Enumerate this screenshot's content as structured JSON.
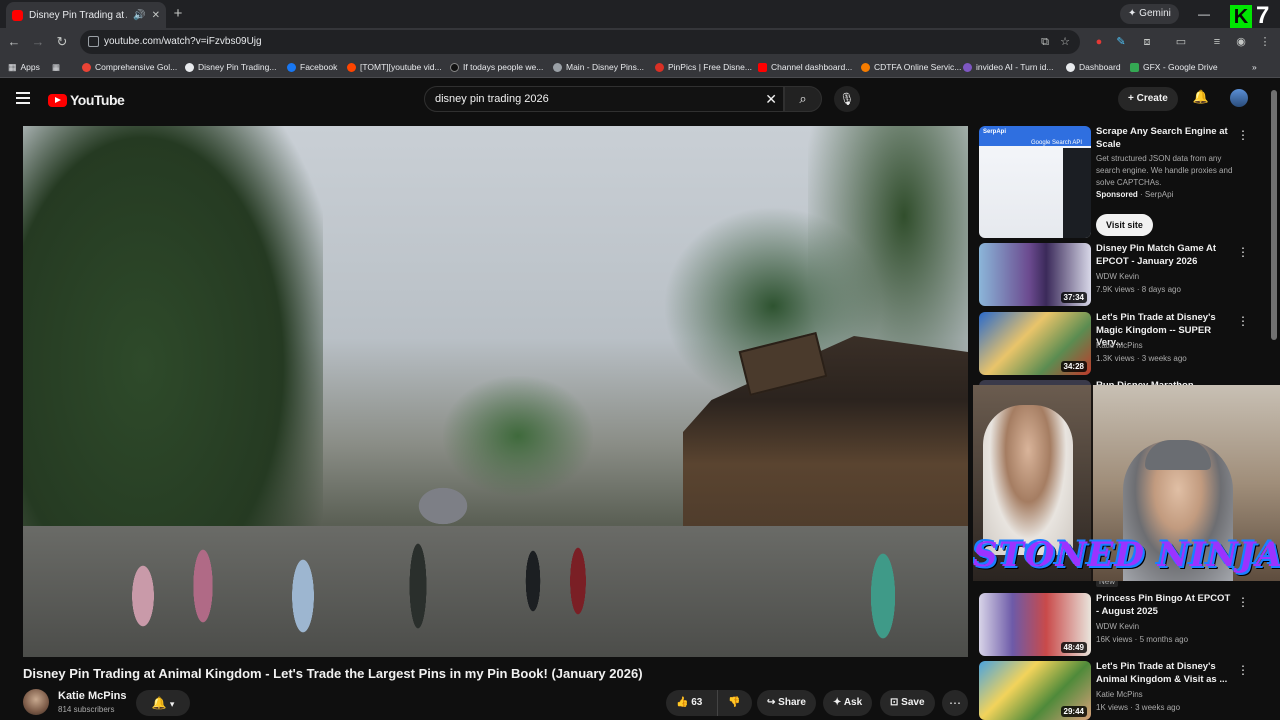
{
  "browser": {
    "tab_title": "Disney Pin Trading at Animal",
    "gemini_label": "Gemini",
    "url": "youtube.com/watch?v=iFzvbs09Ujg",
    "overlay_badge": "7",
    "bookmarks": [
      {
        "label": "Apps"
      },
      {
        "label": "Comprehensive Gol..."
      },
      {
        "label": "Disney Pin Trading..."
      },
      {
        "label": "Facebook"
      },
      {
        "label": "[TOMT][youtube vid..."
      },
      {
        "label": "If todays people we..."
      },
      {
        "label": "Main - Disney Pins..."
      },
      {
        "label": "PinPics | Free Disne..."
      },
      {
        "label": "Channel dashboard..."
      },
      {
        "label": "CDTFA Online Servic..."
      },
      {
        "label": "invideo AI - Turn id..."
      },
      {
        "label": "Dashboard"
      },
      {
        "label": "GFX - Google Drive"
      }
    ]
  },
  "youtube": {
    "logo_text": "YouTube",
    "search_value": "disney pin trading 2026",
    "create_label": "Create"
  },
  "video": {
    "title": "Disney Pin Trading at Animal Kingdom - Let's Trade the Largest Pins in my Pin Book! (January 2026)",
    "channel": "Katie McPins",
    "subscribers": "814 subscribers",
    "likes": "63",
    "share_label": "Share",
    "ask_label": "Ask",
    "save_label": "Save"
  },
  "sidebar": {
    "ad": {
      "title": "Scrape Any Search Engine at Scale",
      "description": "Get structured JSON data from any search engine. We handle proxies and solve CAPTCHAs.",
      "sponsored": "Sponsored",
      "advertiser": "SerpApi",
      "cta": "Visit site",
      "thumb_brand": "SerpApi",
      "thumb_caption": "Google Search API"
    },
    "items": [
      {
        "title": "Disney Pin Match Game At EPCOT - January 2026",
        "channel": "WDW Kevin",
        "meta": "7.9K views · 8 days ago",
        "duration": "37:34"
      },
      {
        "title": "Let's Pin Trade at Disney's Magic Kingdom -- SUPER Very...",
        "channel": "Katie McPins",
        "meta": "1.3K views · 3 weeks ago",
        "duration": "34:28"
      },
      {
        "title": "Run Disney Marathon Weekend",
        "channel": "",
        "meta": "",
        "duration": "",
        "badge": "New"
      },
      {
        "title": "Princess Pin Bingo At EPCOT - August 2025",
        "channel": "WDW Kevin",
        "meta": "16K views · 5 months ago",
        "duration": "48:49"
      },
      {
        "title": "Let's Pin Trade at Disney's Animal Kingdom & Visit as ...",
        "channel": "Katie McPins",
        "meta": "1K views · 3 weeks ago",
        "duration": "29:44"
      }
    ]
  },
  "overlay": {
    "text": "STONED NINJA"
  }
}
